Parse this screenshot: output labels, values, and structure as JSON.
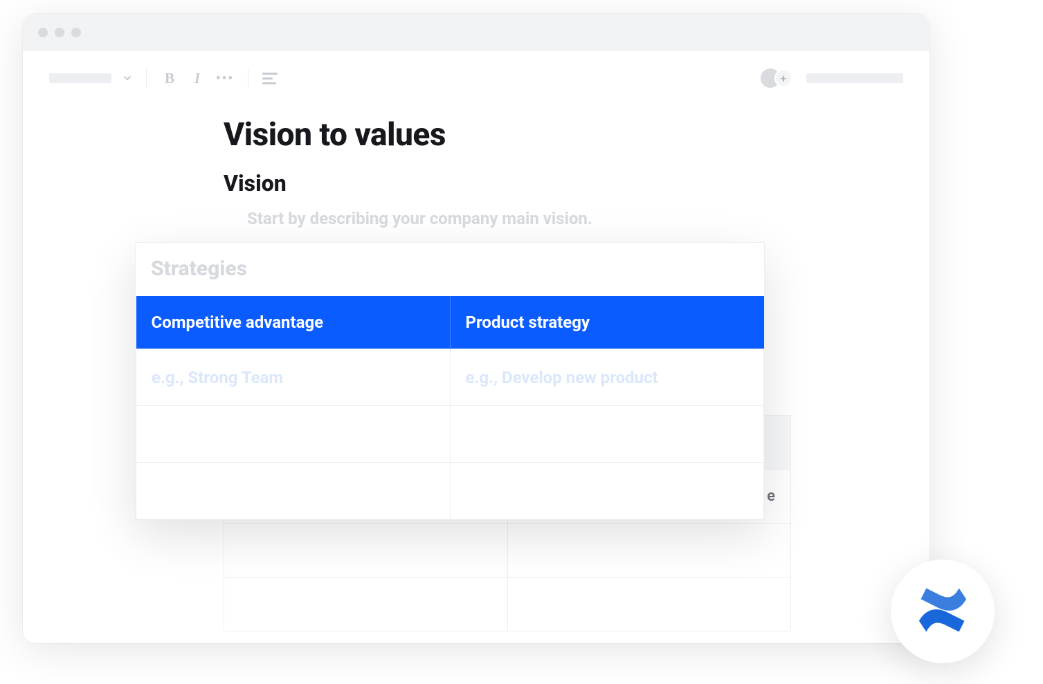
{
  "toolbar": {
    "bold_label": "B",
    "italic_label": "I",
    "more_label": "•••"
  },
  "avatar": {
    "plus_label": "+"
  },
  "doc": {
    "title": "Vision to values",
    "vision_heading": "Vision",
    "vision_hint": "Start by describing your company main vision."
  },
  "bg_table": {
    "col1": "",
    "col2": "",
    "row_label_suffix": "e"
  },
  "strategies_card": {
    "title": "Strategies",
    "col1": "Competitive advantage",
    "col2": "Product strategy",
    "placeholder1": "e.g., Strong Team",
    "placeholder2": "e.g., Develop new product"
  },
  "colors": {
    "accent": "#0b5cff"
  }
}
